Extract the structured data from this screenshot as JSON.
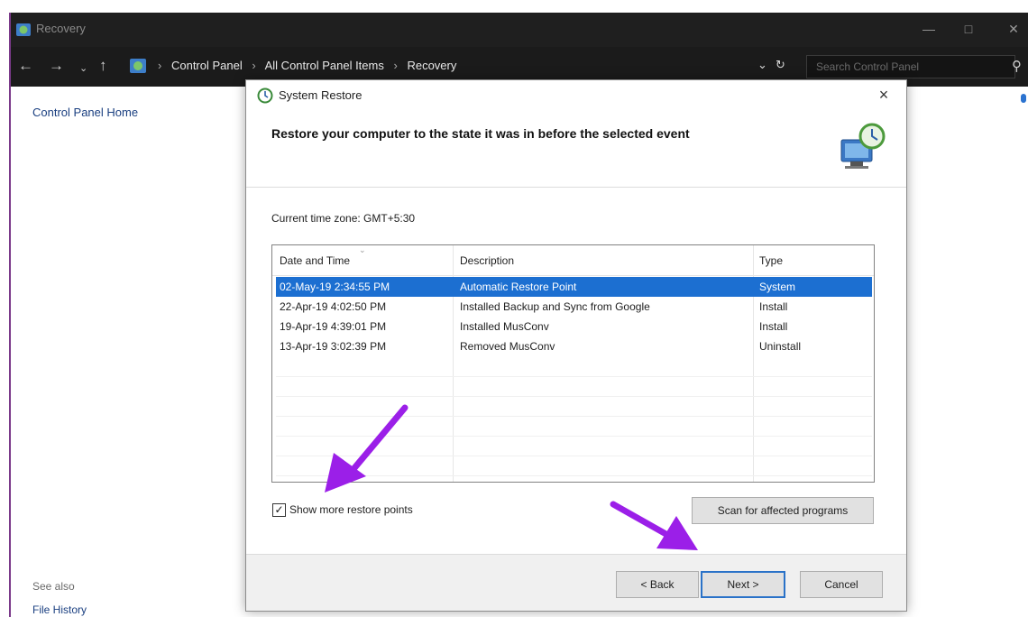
{
  "window": {
    "title": "Recovery"
  },
  "address_bar": {
    "crumbs": [
      "Control Panel",
      "All Control Panel Items",
      "Recovery"
    ],
    "search_placeholder": "Search Control Panel"
  },
  "left_pane": {
    "home_link": "Control Panel Home",
    "see_also": "See also",
    "file_history": "File History"
  },
  "dialog": {
    "title": "System Restore",
    "close_glyph": "×",
    "heading": "Restore your computer to the state it was in before the selected event",
    "timezone": "Current time zone: GMT+5:30",
    "columns": [
      "Date and Time",
      "Description",
      "Type"
    ],
    "rows": [
      {
        "date": "02-May-19 2:34:55 PM",
        "description": "Automatic Restore Point",
        "type": "System",
        "selected": true
      },
      {
        "date": "22-Apr-19 4:02:50 PM",
        "description": "Installed Backup and Sync from Google",
        "type": "Install",
        "selected": false
      },
      {
        "date": "19-Apr-19 4:39:01 PM",
        "description": "Installed MusConv",
        "type": "Install",
        "selected": false
      },
      {
        "date": "13-Apr-19 3:02:39 PM",
        "description": "Removed MusConv",
        "type": "Uninstall",
        "selected": false
      }
    ],
    "show_more_label": "Show more restore points",
    "show_more_checked": true,
    "scan_button": "Scan for affected programs",
    "back_button": "< Back",
    "next_button": "Next >",
    "cancel_button": "Cancel"
  },
  "colors": {
    "selection": "#1c6fd1",
    "annotation_arrow": "#9b1fe8",
    "titlebar": "#1f1f1f"
  }
}
